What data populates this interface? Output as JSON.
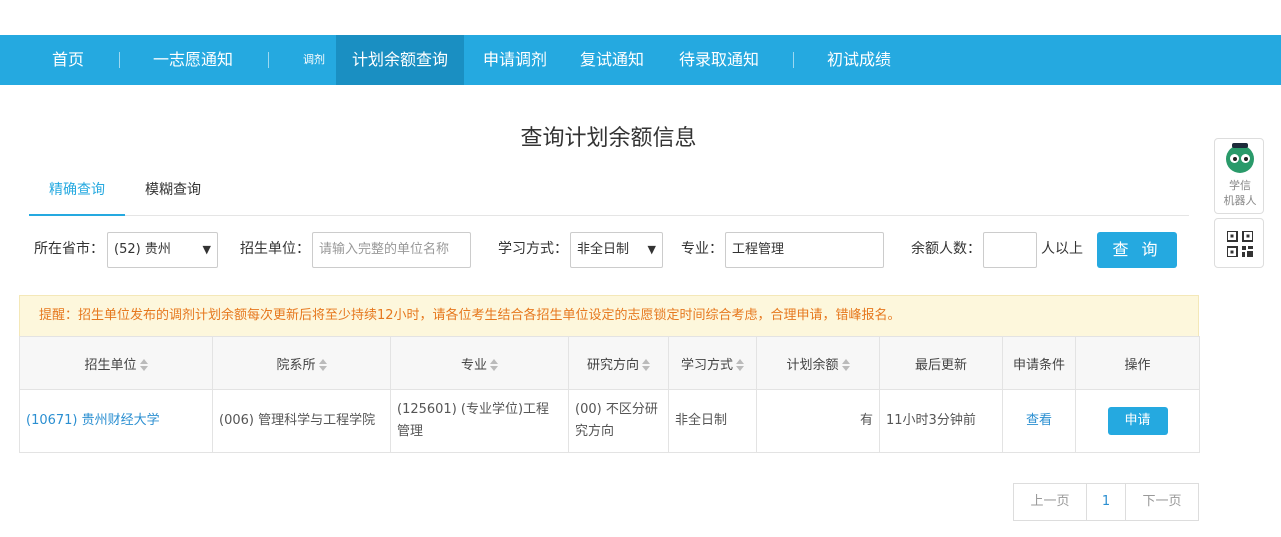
{
  "nav": {
    "items": [
      "首页",
      "一志愿通知",
      "调剂",
      "计划余额查询",
      "申请调剂",
      "复试通知",
      "待录取通知",
      "初试成绩"
    ]
  },
  "page_title": "查询计划余额信息",
  "tabs": [
    "精确查询",
    "模糊查询"
  ],
  "filters": {
    "province_label": "所在省市：",
    "province_value": "(52) 贵州",
    "unit_label": "招生单位：",
    "unit_placeholder": "请输入完整的单位名称",
    "mode_label": "学习方式：",
    "mode_value": "非全日制",
    "major_label": "专业：",
    "major_value": "工程管理",
    "quota_label": "余额人数：",
    "quota_value": "",
    "quota_suffix": "人以上",
    "search_button": "查 询"
  },
  "notice": "提醒：招生单位发布的调剂计划余额每次更新后将至少持续12小时，请各位考生结合各招生单位设定的志愿锁定时间综合考虑，合理申请，错峰报名。",
  "table": {
    "headers": [
      "招生单位",
      "院系所",
      "专业",
      "研究方向",
      "学习方式",
      "计划余额",
      "最后更新",
      "申请条件",
      "操作"
    ],
    "rows": [
      {
        "unit": "(10671) 贵州财经大学",
        "dept": "(006) 管理科学与工程学院",
        "major": "(125601) (专业学位)工程管理",
        "direction": "(00) 不区分研究方向",
        "mode": "非全日制",
        "quota": "有",
        "updated": "11小时3分钟前",
        "condition": "查看",
        "action": "申请"
      }
    ]
  },
  "pagination": {
    "prev": "上一页",
    "current": "1",
    "next": "下一页"
  },
  "side": {
    "robot_label_1": "学信",
    "robot_label_2": "机器人"
  },
  "colors": {
    "brand": "#25a9e0",
    "brand_active": "#1a8fc2",
    "link": "#2b8fd1",
    "notice_text": "#e6781e",
    "notice_bg": "#fdf7dc"
  }
}
